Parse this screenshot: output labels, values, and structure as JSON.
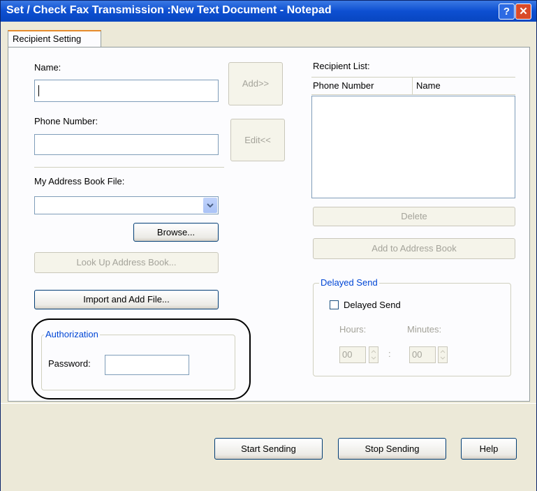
{
  "window": {
    "title": "Set / Check Fax Transmission :New Text Document - Notepad",
    "help_icon": "?",
    "close_icon": "✕"
  },
  "tabs": [
    {
      "label": "Recipient Setting"
    }
  ],
  "left": {
    "name_label": "Name:",
    "name_value": "",
    "phone_label": "Phone Number:",
    "phone_value": "",
    "addressbook_label": "My Address Book File:",
    "addressbook_value": "",
    "browse_button": "Browse...",
    "lookup_button": "Look Up Address Book...",
    "import_button": "Import and Add File..."
  },
  "middle": {
    "add_button": "Add>>",
    "edit_button": "Edit<<"
  },
  "recipient_list": {
    "label": "Recipient List:",
    "columns": [
      "Phone Number",
      "Name"
    ],
    "rows": [],
    "delete_button": "Delete",
    "add_to_book_button": "Add to Address Book"
  },
  "delayed_send": {
    "group_title": "Delayed Send",
    "checkbox_label": "Delayed Send",
    "checked": false,
    "hours_label": "Hours:",
    "minutes_label": "Minutes:",
    "hours_value": "00",
    "minutes_value": "00",
    "separator": ":"
  },
  "authorization": {
    "group_title": "Authorization",
    "password_label": "Password:",
    "password_value": ""
  },
  "footer": {
    "start_button": "Start Sending",
    "stop_button": "Stop Sending",
    "help_button": "Help"
  },
  "colors": {
    "titlebar": "#0d4fd1",
    "group_title": "#0046d5",
    "tab_highlight": "#e68b2c",
    "close_button": "#d94a29"
  }
}
